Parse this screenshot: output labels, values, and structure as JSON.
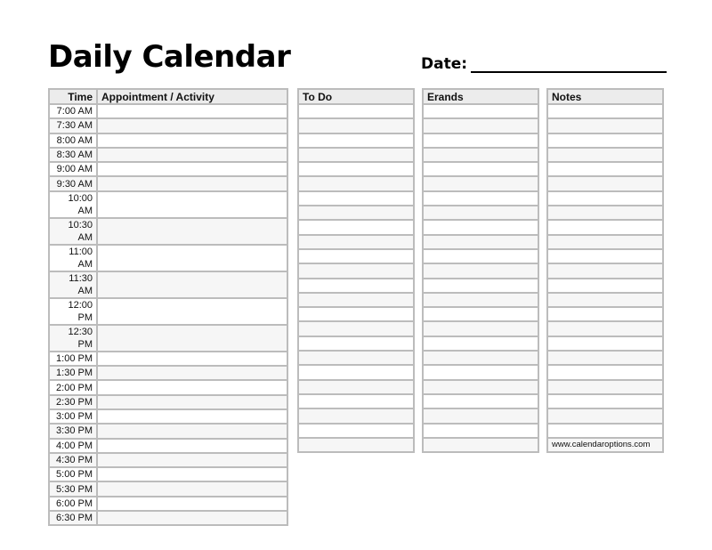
{
  "title": "Daily Calendar",
  "date_label": "Date:",
  "schedule": {
    "headers": {
      "time": "Time",
      "activity": "Appointment / Activity"
    },
    "times": [
      "7:00 AM",
      "7:30 AM",
      "8:00 AM",
      "8:30 AM",
      "9:00 AM",
      "9:30 AM",
      "10:00 AM",
      "10:30 AM",
      "11:00 AM",
      "11:30 AM",
      "12:00 PM",
      "12:30 PM",
      "1:00 PM",
      "1:30 PM",
      "2:00 PM",
      "2:30 PM",
      "3:00 PM",
      "3:30 PM",
      "4:00 PM",
      "4:30 PM",
      "5:00 PM",
      "5:30 PM",
      "6:00 PM",
      "6:30 PM"
    ]
  },
  "todo": {
    "header": "To Do"
  },
  "errands": {
    "header": "Erands"
  },
  "notes": {
    "header": "Notes",
    "footer_url": "www.calendaroptions.com"
  }
}
